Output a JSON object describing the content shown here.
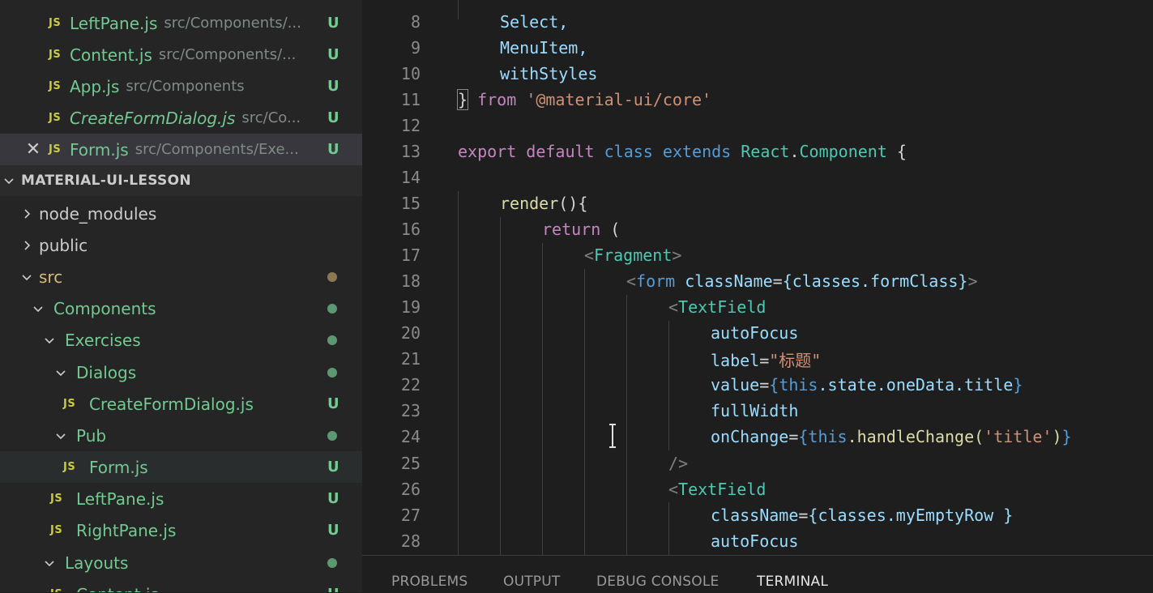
{
  "open_editors": [
    {
      "name": "LeftPane.js",
      "path": "src/Components/...",
      "status": "U",
      "italic": false
    },
    {
      "name": "Content.js",
      "path": "src/Components/...",
      "status": "U",
      "italic": false
    },
    {
      "name": "App.js",
      "path": "src/Components",
      "status": "U",
      "italic": false
    },
    {
      "name": "CreateFormDialog.js",
      "path": "src/Co...",
      "status": "U",
      "italic": true
    },
    {
      "name": "Form.js",
      "path": "src/Components/Exe...",
      "status": "U",
      "italic": false,
      "close": "✕"
    }
  ],
  "js_label": "JS",
  "explorer_section": "MATERIAL-UI-LESSON",
  "tree": [
    {
      "label": "node_modules"
    },
    {
      "label": "public"
    },
    {
      "label": "src"
    },
    {
      "label": "Components"
    },
    {
      "label": "Exercises"
    },
    {
      "label": "Dialogs"
    },
    {
      "label": "CreateFormDialog.js",
      "status": "U"
    },
    {
      "label": "Pub"
    },
    {
      "label": "Form.js",
      "status": "U"
    },
    {
      "label": "LeftPane.js",
      "status": "U"
    },
    {
      "label": "RightPane.js",
      "status": "U"
    },
    {
      "label": "Layouts"
    },
    {
      "label": "Content.js",
      "status": "U"
    }
  ],
  "code": {
    "line_numbers": [
      "8",
      "9",
      "10",
      "11",
      "12",
      "13",
      "14",
      "15",
      "16",
      "17",
      "18",
      "19",
      "20",
      "21",
      "22",
      "23",
      "24",
      "25",
      "26",
      "27",
      "28"
    ],
    "l8": "Select,",
    "l9": "MenuItem,",
    "l10": "withStyles",
    "l11_brace": "}",
    "l11_from": "from",
    "l11_str": "'@material-ui/core'",
    "l13_export": "export",
    "l13_default": "default",
    "l13_class": "class",
    "l13_extends": "extends",
    "l13_react": "React",
    "l13_dot": ".",
    "l13_comp": "Component",
    "l13_brace": " {",
    "l15_render": "render",
    "l15_rest": "(){",
    "l16_return": "return",
    "l16_paren": " (",
    "l17_open": "<",
    "l17_tag": "Fragment",
    "l17_close": ">",
    "l18_open": "<",
    "l18_tag": "form",
    "l18_attr": " className",
    "l18_eq": "=",
    "l18_val": "{classes.formClass}",
    "l18_close": ">",
    "l19_open": "<",
    "l19_tag": "TextField",
    "l20": "autoFocus",
    "l21_attr": "label",
    "l21_eq": "=",
    "l21_val": "\"标题\"",
    "l22_attr": "value",
    "l22_eq": "=",
    "l22_ob": "{",
    "l22_this": "this",
    "l22_rest": ".state.oneData.title",
    "l22_cb": "}",
    "l23": "fullWidth",
    "l24_attr": "onChange",
    "l24_eq": "=",
    "l24_ob": "{",
    "l24_this": "this",
    "l24_fn": ".handleChange(",
    "l24_str": "'title'",
    "l24_cp": ")",
    "l24_cb": "}",
    "l25": "/>",
    "l26_open": "<",
    "l26_tag": "TextField",
    "l27_attr": "className",
    "l27_eq": "=",
    "l27_val": "{classes.myEmptyRow }",
    "l28": "autoFocus"
  },
  "panel_tabs": [
    "PROBLEMS",
    "OUTPUT",
    "DEBUG CONSOLE",
    "TERMINAL"
  ],
  "colors": {
    "modified_green": "#73c991",
    "js_yellow": "#cbcb41",
    "keyword_blue": "#569cd6",
    "string_orange": "#ce9178"
  }
}
